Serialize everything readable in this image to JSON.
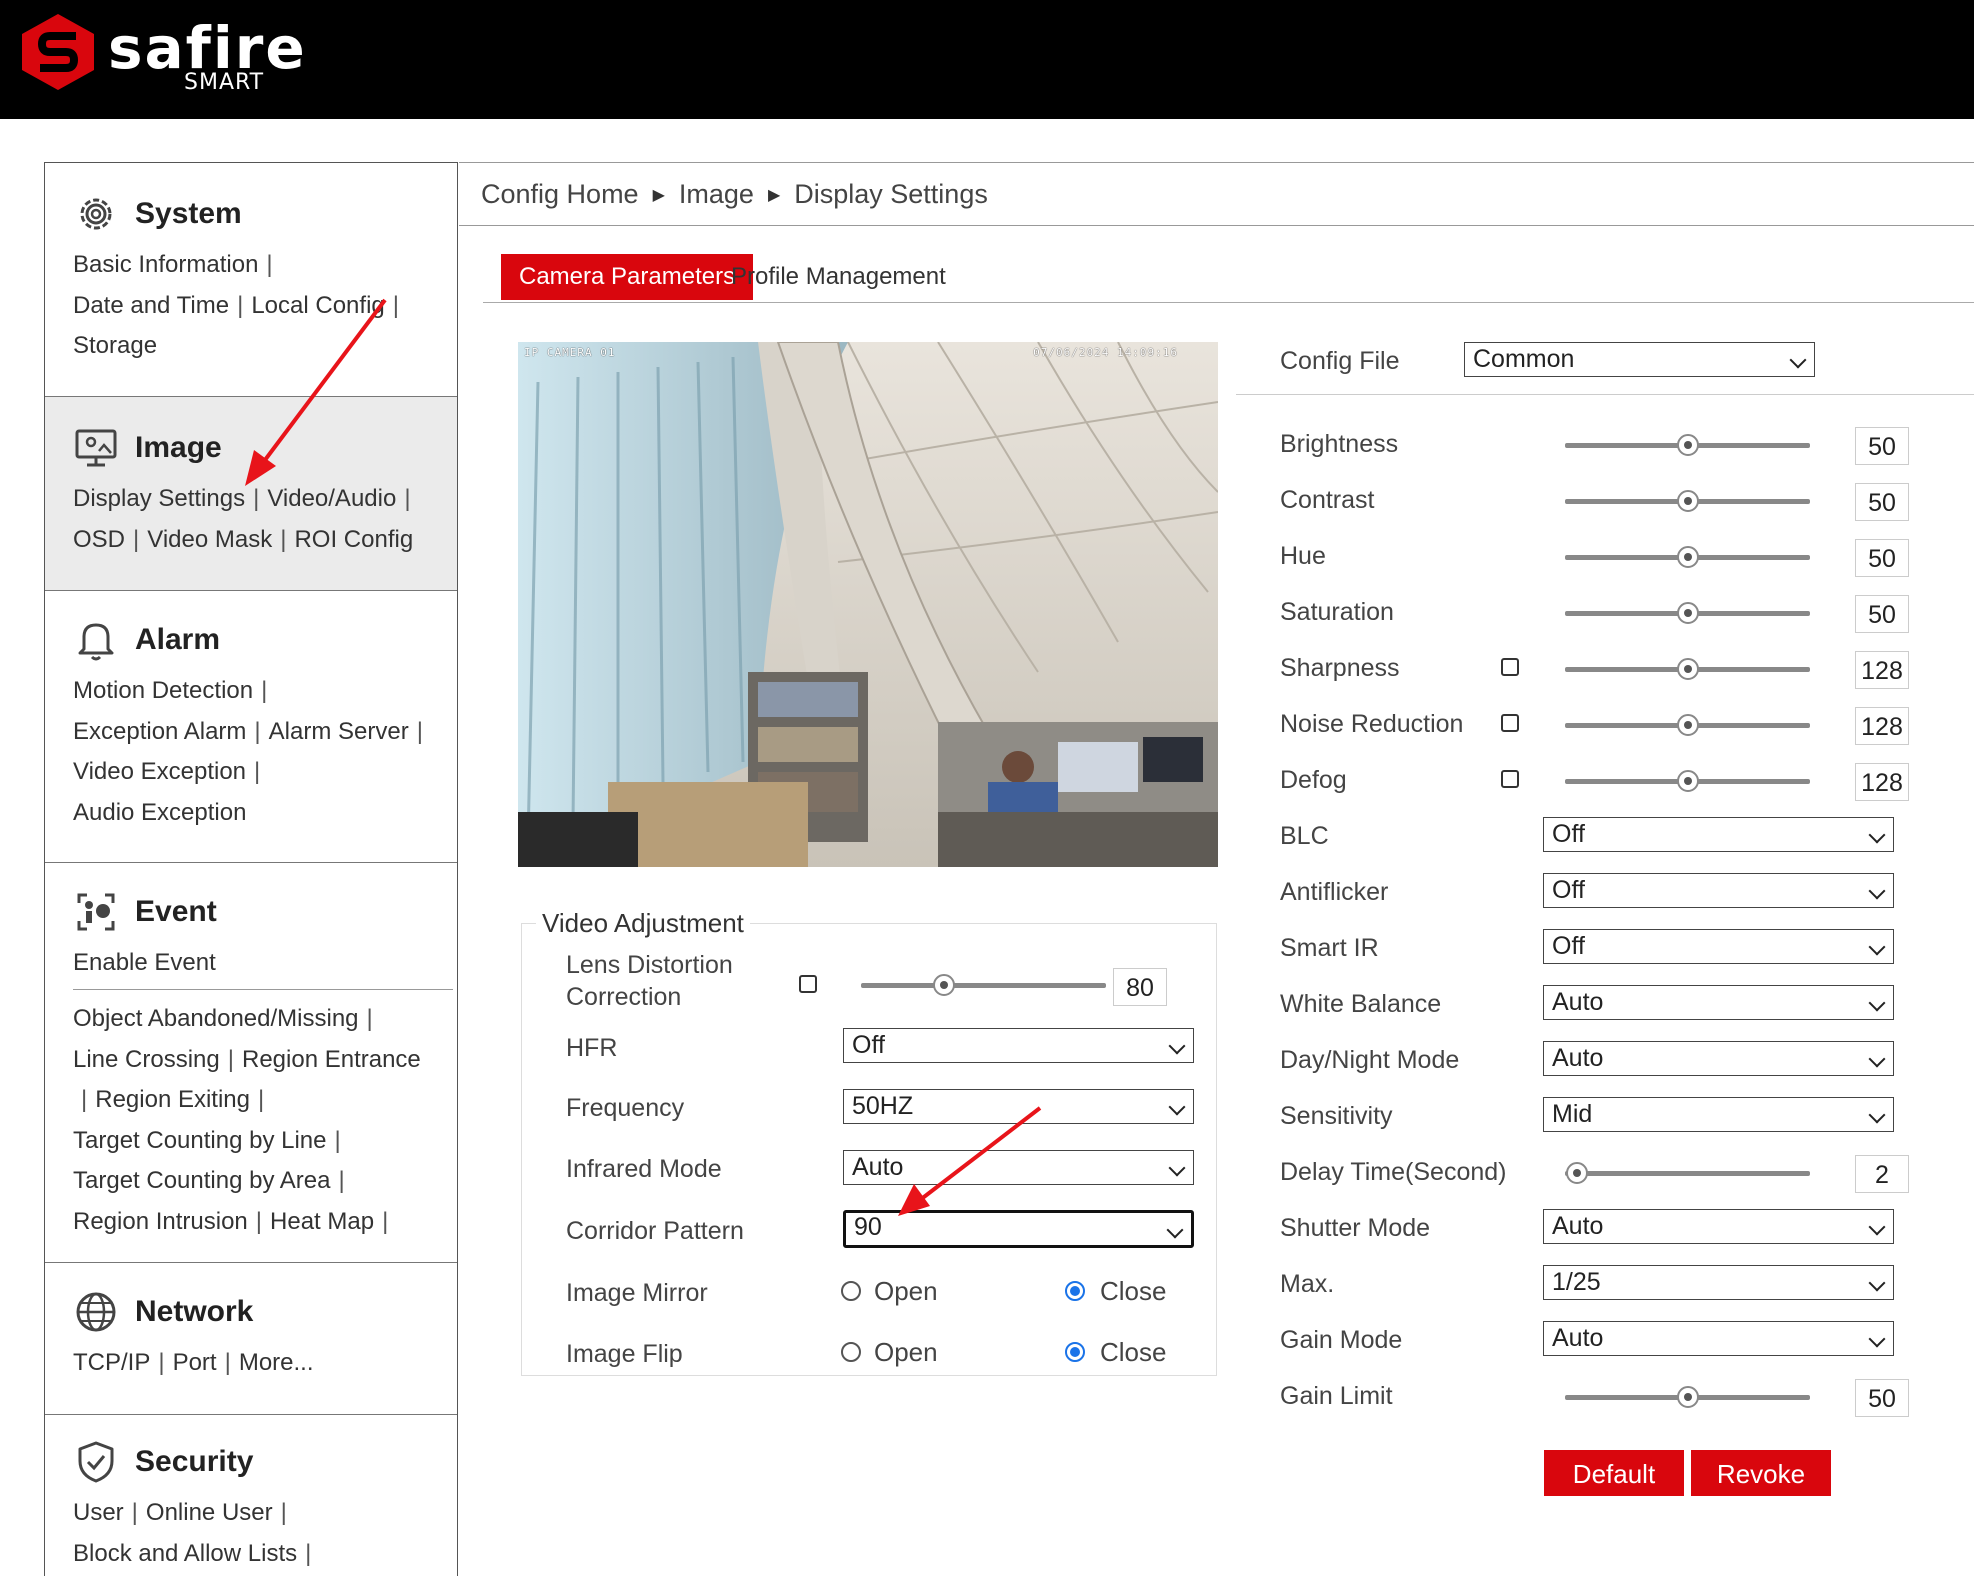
{
  "brand": {
    "name": "safire",
    "sub": "SMART"
  },
  "sidebar": {
    "system": {
      "title": "System",
      "links": [
        "Basic Information",
        "Date and Time",
        "Local Config",
        "Storage"
      ]
    },
    "image": {
      "title": "Image",
      "links": [
        "Display Settings",
        "Video/Audio",
        "OSD",
        "Video Mask",
        "ROI Config"
      ]
    },
    "alarm": {
      "title": "Alarm",
      "links": [
        "Motion Detection",
        "Exception Alarm",
        "Alarm Server",
        "Video Exception",
        "Audio Exception"
      ]
    },
    "event": {
      "title": "Event",
      "links": [
        "Enable Event",
        "Object Abandoned/Missing",
        "Line Crossing",
        "Region Entrance",
        "Region Exiting",
        "Target Counting by Line",
        "Target Counting by Area",
        "Region Intrusion",
        "Heat Map"
      ]
    },
    "network": {
      "title": "Network",
      "links": [
        "TCP/IP",
        "Port",
        "More..."
      ]
    },
    "security": {
      "title": "Security",
      "links": [
        "User",
        "Online User",
        "Block and Allow Lists"
      ]
    }
  },
  "breadcrumb": [
    "Config Home",
    "Image",
    "Display Settings"
  ],
  "tabs": [
    "Camera Parameters",
    "Profile Management"
  ],
  "video": {
    "osd_left": "IP CAMERA 01",
    "osd_right": "07/06/2024 14:09:16"
  },
  "video_adjustment": {
    "legend": "Video Adjustment",
    "lens_distortion": {
      "label": "Lens Distortion Correction",
      "checked": false,
      "value": 80,
      "level": 0.34
    },
    "hfr": {
      "label": "HFR",
      "value": "Off"
    },
    "frequency": {
      "label": "Frequency",
      "value": "50HZ"
    },
    "infrared_mode": {
      "label": "Infrared Mode",
      "value": "Auto"
    },
    "corridor_pattern": {
      "label": "Corridor Pattern",
      "value": "90"
    },
    "image_mirror": {
      "label": "Image Mirror",
      "open": "Open",
      "close": "Close",
      "selected": "Close"
    },
    "image_flip": {
      "label": "Image Flip",
      "open": "Open",
      "close": "Close",
      "selected": "Close"
    }
  },
  "config_file": {
    "label": "Config File",
    "value": "Common"
  },
  "params": {
    "brightness": {
      "label": "Brightness",
      "value": "50",
      "level": 0.5
    },
    "contrast": {
      "label": "Contrast",
      "value": "50",
      "level": 0.5
    },
    "hue": {
      "label": "Hue",
      "value": "50",
      "level": 0.5
    },
    "saturation": {
      "label": "Saturation",
      "value": "50",
      "level": 0.5
    },
    "sharpness": {
      "label": "Sharpness",
      "value": "128",
      "level": 0.5,
      "checked": false
    },
    "noise_reduction": {
      "label": "Noise Reduction",
      "value": "128",
      "level": 0.5,
      "checked": false
    },
    "defog": {
      "label": "Defog",
      "value": "128",
      "level": 0.5,
      "checked": false
    },
    "blc": {
      "label": "BLC",
      "value": "Off"
    },
    "antiflicker": {
      "label": "Antiflicker",
      "value": "Off"
    },
    "smart_ir": {
      "label": "Smart IR",
      "value": "Off"
    },
    "white_balance": {
      "label": "White Balance",
      "value": "Auto"
    },
    "day_night": {
      "label": "Day/Night Mode",
      "value": "Auto"
    },
    "sensitivity": {
      "label": "Sensitivity",
      "value": "Mid"
    },
    "delay_time": {
      "label": "Delay Time(Second)",
      "value": "2",
      "level": 0.05
    },
    "shutter_mode": {
      "label": "Shutter Mode",
      "value": "Auto"
    },
    "max": {
      "label": "Max.",
      "value": "1/25"
    },
    "gain_mode": {
      "label": "Gain Mode",
      "value": "Auto"
    },
    "gain_limit": {
      "label": "Gain Limit",
      "value": "50",
      "level": 0.5
    }
  },
  "buttons": {
    "default": "Default",
    "revoke": "Revoke"
  },
  "colors": {
    "accent": "#d9060d",
    "radio": "#1a73e8",
    "annotation_arrow": "#e8141a"
  }
}
